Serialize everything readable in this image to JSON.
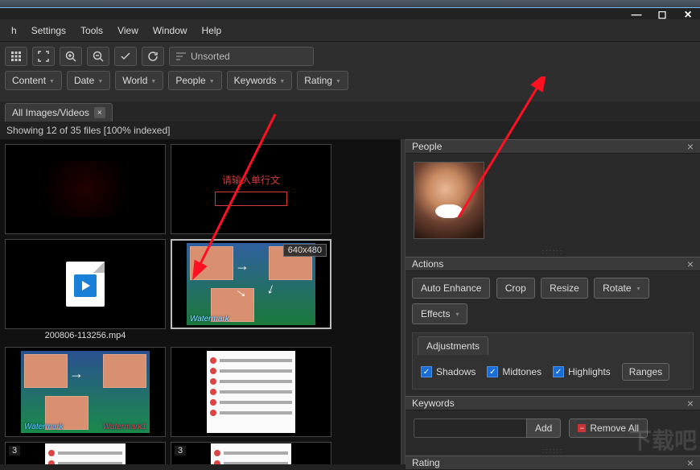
{
  "menu": {
    "items": [
      "h",
      "Settings",
      "Tools",
      "View",
      "Window",
      "Help"
    ]
  },
  "toolbar": {
    "sort_label": "Unsorted"
  },
  "filters": {
    "content": "Content",
    "date": "Date",
    "world": "World",
    "people": "People",
    "keywords": "Keywords",
    "rating": "Rating"
  },
  "tab": {
    "label": "All Images/Videos"
  },
  "status": {
    "text": "Showing 12 of 35 files [100% indexed]"
  },
  "thumbs": {
    "video_name": "200806-113256.mp4",
    "red_text": "请输入单行文",
    "dim_badge": "640x480",
    "watermark_label": "Watermark",
    "badge_3a": "3",
    "badge_3b": "3"
  },
  "panels": {
    "people": {
      "title": "People"
    },
    "actions": {
      "title": "Actions",
      "auto_enhance": "Auto Enhance",
      "crop": "Crop",
      "resize": "Resize",
      "rotate": "Rotate",
      "effects": "Effects",
      "adjustments_tab": "Adjustments",
      "shadows": "Shadows",
      "midtones": "Midtones",
      "highlights": "Highlights",
      "ranges": "Ranges"
    },
    "keywords": {
      "title": "Keywords",
      "add": "Add",
      "remove_all": "Remove All"
    },
    "rating": {
      "title": "Rating"
    }
  }
}
